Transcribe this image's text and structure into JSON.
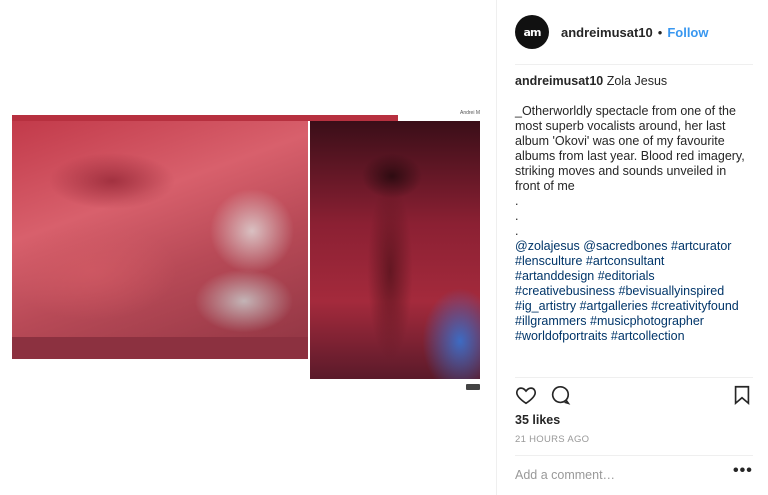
{
  "post": {
    "username": "andreimusat10",
    "separator": "•",
    "follow_label": "Follow",
    "avatar_text": "am",
    "media": {
      "corner_text": "Andrei M",
      "colors": {
        "primary_red": "#c23a4a",
        "dark_red": "#8c3140",
        "blue_glow": "#3278dc"
      }
    }
  },
  "caption": {
    "username": "andreimusat10",
    "title": "Zola Jesus",
    "body": "_Otherworldly spectacle from one of the most superb vocalists around, her last album 'Okovi' was one of my favourite albums from last year. Blood red imagery, striking moves and sounds unveiled in front of me",
    "dots": ".\n.\n.",
    "tags": "@zolajesus @sacredbones #artcurator #lensculture #artconsultant #artanddesign #editorials #creativebusiness #bevisuallyinspired #ig_artistry #artgalleries #creativityfound #illgrammers #musicphotographer #worldofportraits #artcollection"
  },
  "actions": {
    "like_icon": "heart-icon",
    "comment_icon": "comment-icon",
    "save_icon": "bookmark-icon"
  },
  "stats": {
    "likes": "35 likes",
    "time": "21 HOURS AGO"
  },
  "comment": {
    "placeholder": "Add a comment…",
    "more": "•••"
  },
  "colors": {
    "link_blue": "#3897f0",
    "hashtag_blue": "#003569",
    "text": "#262626",
    "muted": "#999999"
  }
}
